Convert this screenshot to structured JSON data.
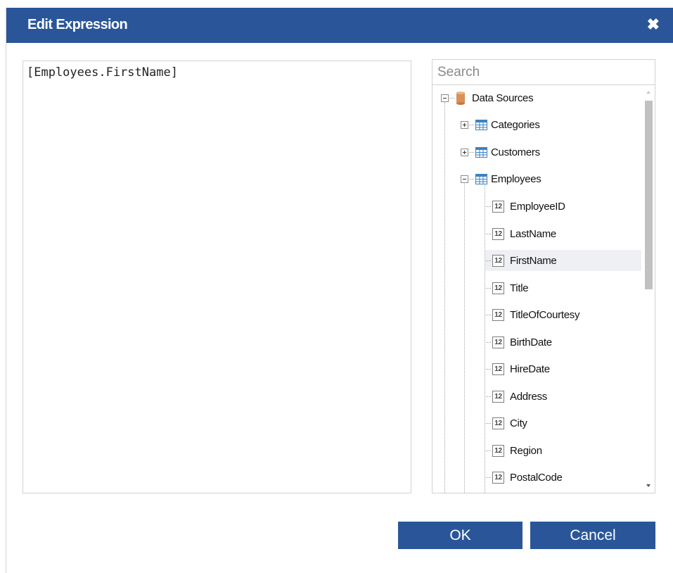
{
  "dialog": {
    "title": "Edit Expression",
    "close_glyph": "✖"
  },
  "editor": {
    "value": "[Employees.FirstName]"
  },
  "search": {
    "placeholder": "Search",
    "value": ""
  },
  "tree": {
    "root": {
      "label": "Data Sources",
      "icon": "database-icon",
      "expanded": true
    },
    "tables": [
      {
        "label": "Categories",
        "icon": "table-icon",
        "expanded": false
      },
      {
        "label": "Customers",
        "icon": "table-icon",
        "expanded": false
      },
      {
        "label": "Employees",
        "icon": "table-icon",
        "expanded": true
      }
    ],
    "field_icon_text": "12",
    "fields": [
      {
        "label": "EmployeeID"
      },
      {
        "label": "LastName"
      },
      {
        "label": "FirstName",
        "selected": true
      },
      {
        "label": "Title"
      },
      {
        "label": "TitleOfCourtesy"
      },
      {
        "label": "BirthDate"
      },
      {
        "label": "HireDate"
      },
      {
        "label": "Address"
      },
      {
        "label": "City"
      },
      {
        "label": "Region"
      },
      {
        "label": "PostalCode"
      }
    ]
  },
  "buttons": {
    "ok_label": "OK",
    "cancel_label": "Cancel"
  },
  "colors": {
    "header": "#2a5699",
    "button": "#2a5699",
    "selection": "#eef0f3"
  }
}
